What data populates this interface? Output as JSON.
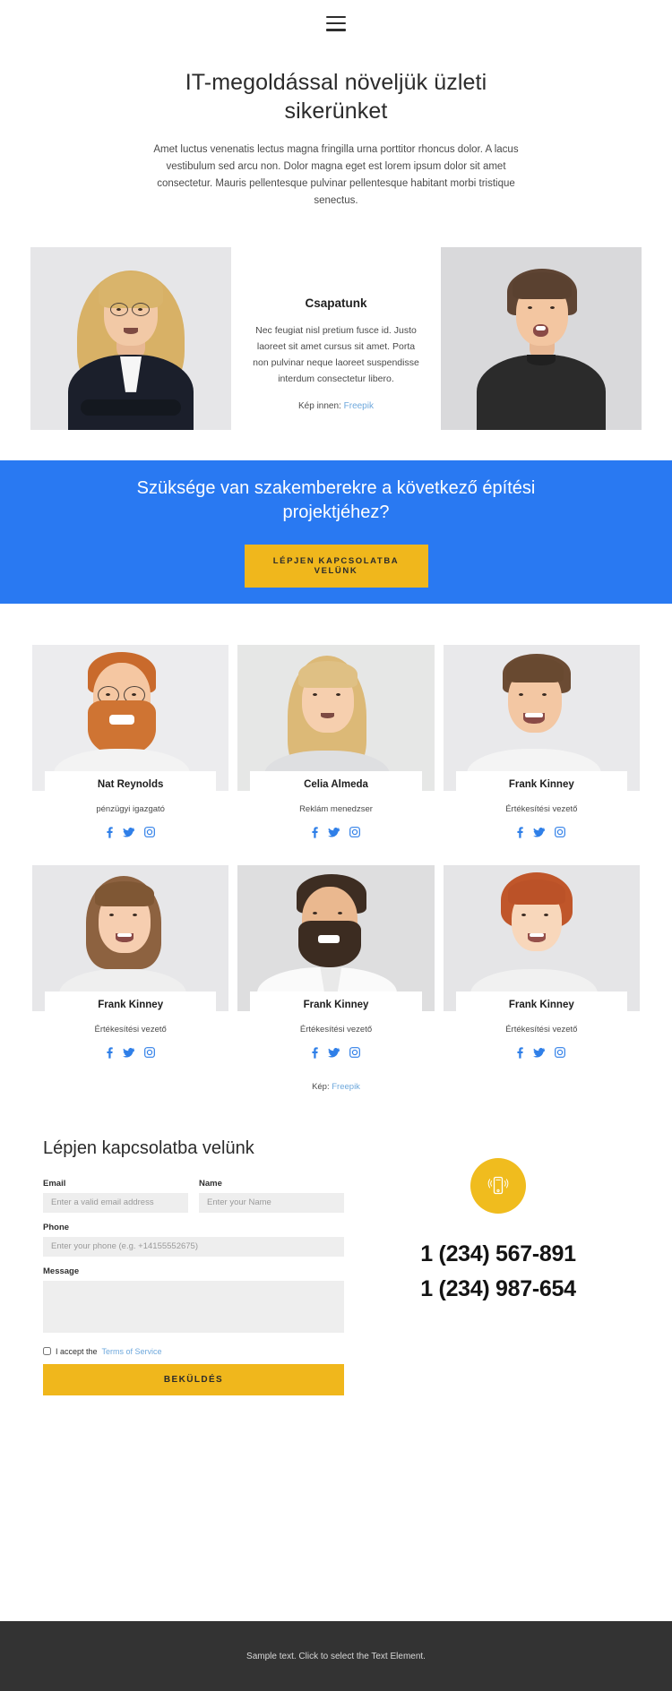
{
  "header": {
    "menu_icon": "hamburger-icon"
  },
  "hero": {
    "title": "IT-megoldással növeljük üzleti sikerünket",
    "paragraph": "Amet luctus venenatis lectus magna fringilla urna porttitor rhoncus dolor. A lacus vestibulum sed arcu non. Dolor magna eget est lorem ipsum dolor sit amet consectetur. Mauris pellentesque pulvinar pellentesque habitant morbi tristique senectus."
  },
  "intro": {
    "heading": "Csapatunk",
    "paragraph": "Nec feugiat nisl pretium fusce id. Justo laoreet sit amet cursus sit amet. Porta non pulvinar neque laoreet suspendisse interdum consectetur libero.",
    "credit_label": "Kép innen:",
    "credit_link": "Freepik",
    "left_photo_alt": "businesswoman-portrait",
    "right_photo_alt": "young-man-portrait"
  },
  "cta": {
    "heading": "Szüksége van szakemberekre a következő építési projektjéhez?",
    "button": "LÉPJEN KAPCSOLATBA VELÜNK",
    "background": "#2979f2",
    "button_color": "#f0b71c"
  },
  "team": {
    "members": [
      {
        "name": "Nat Reynolds",
        "role": "pénzügyi igazgató",
        "photo_alt": "bearded-man-glasses"
      },
      {
        "name": "Celia Almeda",
        "role": "Reklám menedzser",
        "photo_alt": "blonde-woman"
      },
      {
        "name": "Frank Kinney",
        "role": "Értékesítési vezető",
        "photo_alt": "smiling-young-man"
      },
      {
        "name": "Frank Kinney",
        "role": "Értékesítési vezető",
        "photo_alt": "woman-bob-haircut"
      },
      {
        "name": "Frank Kinney",
        "role": "Értékesítési vezető",
        "photo_alt": "bearded-man-shirt"
      },
      {
        "name": "Frank Kinney",
        "role": "Értékesítési vezető",
        "photo_alt": "redhead-woman"
      }
    ],
    "social_icons": [
      "facebook-icon",
      "twitter-icon",
      "instagram-icon"
    ],
    "social_color": "#2f7fe8",
    "credit_label": "Kép:",
    "credit_link": "Freepik"
  },
  "contact": {
    "heading": "Lépjen kapcsolatba velünk",
    "fields": {
      "email": {
        "label": "Email",
        "placeholder": "Enter a valid email address",
        "value": ""
      },
      "name": {
        "label": "Name",
        "placeholder": "Enter your Name",
        "value": ""
      },
      "phone": {
        "label": "Phone",
        "placeholder": "Enter your phone (e.g. +14155552675)",
        "value": ""
      },
      "message": {
        "label": "Message",
        "placeholder": "",
        "value": ""
      }
    },
    "terms_text": "I accept the",
    "terms_link": "Terms of Service",
    "submit": "BEKÜLDÉS",
    "phone_icon": "mobile-phone-icon",
    "phone_numbers": [
      "1 (234) 567-891",
      "1 (234) 987-654"
    ],
    "badge_color": "#f0bc1e"
  },
  "footer": {
    "text": "Sample text. Click to select the Text Element."
  }
}
